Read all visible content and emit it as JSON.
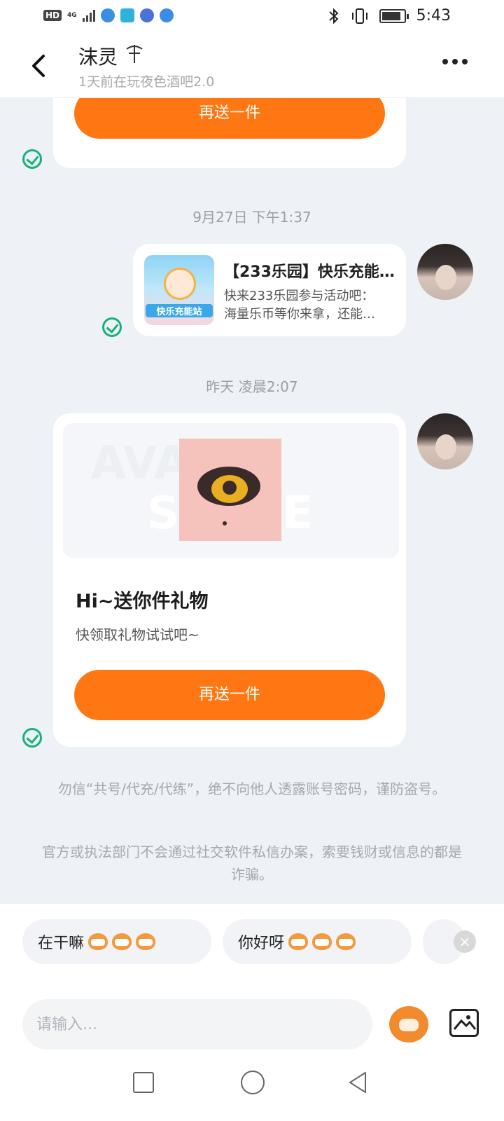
{
  "status": {
    "net": "4G",
    "time": "5:43"
  },
  "header": {
    "name": "沫灵",
    "sub": "1天前在玩夜色酒吧2.0"
  },
  "messages": {
    "resend_label": "再送一件",
    "timestamp1": "9月27日 下午1:37",
    "promo_title": "【233乐园】快乐充能…",
    "promo_desc_line1": "快来233乐园参与活动吧：",
    "promo_desc_line2": "海量乐币等你来拿，还能…",
    "promo_logo_text": "快乐充能站",
    "timestamp2": "昨天 凌晨2:07",
    "gift_hero_text1": "AVATAR",
    "gift_hero_text2": "STORE",
    "gift_title": "Hi~送你件礼物",
    "gift_desc": "快领取礼物试试吧~"
  },
  "notices": {
    "line1": "勿信“共号/代充/代练”，绝不向他人透露账号密码，谨防盗号。",
    "line2": "官方或执法部门不会通过社交软件私信办案，索要钱财或信息的都是诈骗。"
  },
  "quick_replies": [
    {
      "label": "在干嘛"
    },
    {
      "label": "你好呀"
    }
  ],
  "input": {
    "placeholder": "请输入..."
  },
  "icons": {
    "back": "chevron-left-icon",
    "more": "more-icon",
    "check": "check-circle-icon",
    "emoji": "emoji-icon",
    "image": "image-icon",
    "close": "close-icon"
  },
  "colors": {
    "accent": "#ff7712",
    "check": "#17b27a"
  }
}
